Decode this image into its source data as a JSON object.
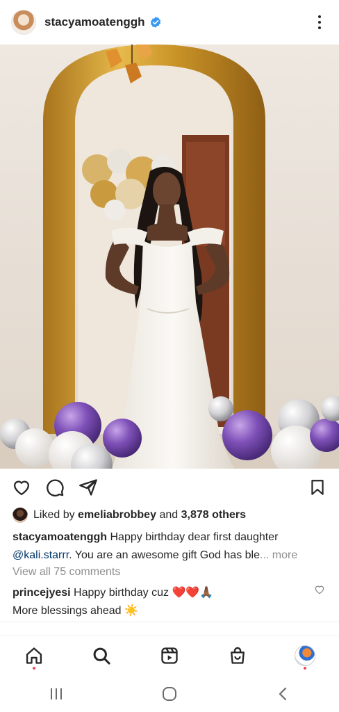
{
  "post": {
    "username": "stacyamoatenggh",
    "verified": true,
    "photo_alt": "Woman in white gown standing in front of golden arch with balloons"
  },
  "likes": {
    "prefix": "Liked by",
    "liker": "emeliabrobbey",
    "joiner": "and",
    "others": "3,878 others"
  },
  "caption": {
    "username": "stacyamoatenggh",
    "text_before": " Happy birthday dear first daughter ",
    "mention": "@kali.starrr",
    "text_after": ". You are an awesome gift God has ble",
    "more": "... more"
  },
  "comments_link": "View all 75 comments",
  "top_comment": {
    "username": "princejyesi",
    "text": " Happy birthday cuz ❤️❤️🙏🏾",
    "line2": "More blessings ahead ☀️"
  },
  "nav": {
    "items": [
      "home-icon",
      "search-icon",
      "reels-icon",
      "shop-icon",
      "profile-avatar"
    ]
  },
  "colors": {
    "verified_blue": "#3897f0",
    "mention_blue": "#00376b",
    "muted_gray": "#8e8e8e",
    "notification_red": "#ed4956",
    "gold_arch": "#c9962a"
  }
}
